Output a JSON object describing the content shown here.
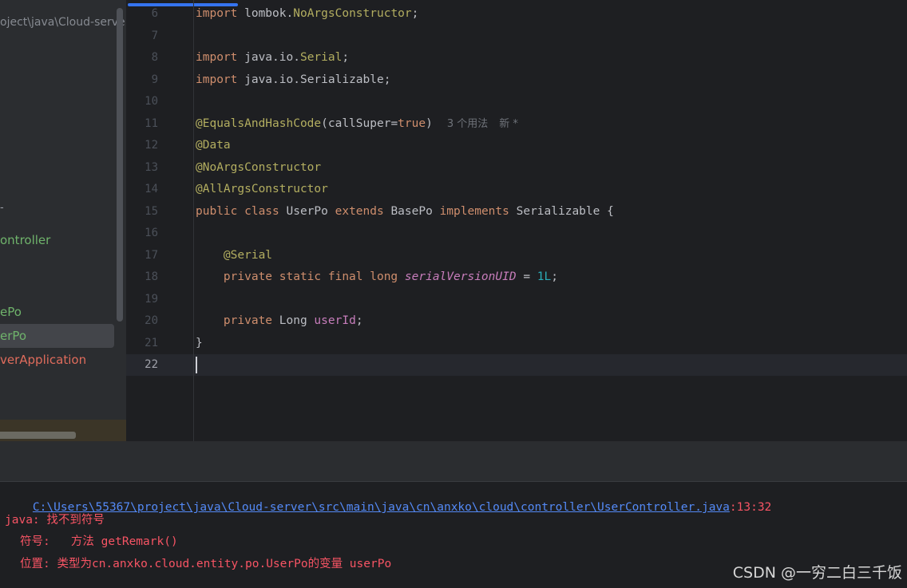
{
  "sidebar": {
    "path_text": "oject\\java\\Cloud-serve",
    "dash": "-",
    "items": [
      {
        "label": "ontroller"
      },
      {
        "label": "ePo"
      },
      {
        "label": "erPo"
      },
      {
        "label": "verApplication"
      }
    ]
  },
  "editor": {
    "lines": [
      {
        "n": "6",
        "tokens": [
          [
            "kw",
            "import"
          ],
          [
            "plain",
            " lombok."
          ],
          [
            "ann",
            "NoArgsConstructor"
          ],
          [
            "plain",
            ";"
          ]
        ]
      },
      {
        "n": "7",
        "tokens": []
      },
      {
        "n": "8",
        "tokens": [
          [
            "kw",
            "import"
          ],
          [
            "plain",
            " java.io."
          ],
          [
            "ann",
            "Serial"
          ],
          [
            "plain",
            ";"
          ]
        ]
      },
      {
        "n": "9",
        "tokens": [
          [
            "kw",
            "import"
          ],
          [
            "plain",
            " java.io.Serializable;"
          ]
        ]
      },
      {
        "n": "10",
        "tokens": []
      },
      {
        "n": "11",
        "tokens": [
          [
            "ann",
            "@EqualsAndHashCode"
          ],
          [
            "plain",
            "(callSuper="
          ],
          [
            "kw",
            "true"
          ],
          [
            "plain",
            ")"
          ],
          [
            "inlay",
            "3 个用法"
          ],
          [
            "inlay2",
            "新 *"
          ]
        ]
      },
      {
        "n": "12",
        "tokens": [
          [
            "ann",
            "@Data"
          ]
        ]
      },
      {
        "n": "13",
        "tokens": [
          [
            "ann",
            "@NoArgsConstructor"
          ]
        ]
      },
      {
        "n": "14",
        "tokens": [
          [
            "ann",
            "@AllArgsConstructor"
          ]
        ]
      },
      {
        "n": "15",
        "tokens": [
          [
            "kw",
            "public class"
          ],
          [
            "plain",
            " UserPo "
          ],
          [
            "kw",
            "extends"
          ],
          [
            "plain",
            " BasePo "
          ],
          [
            "kw",
            "implements"
          ],
          [
            "plain",
            " Serializable {"
          ]
        ]
      },
      {
        "n": "16",
        "tokens": []
      },
      {
        "n": "17",
        "tokens": [
          [
            "plain",
            "    "
          ],
          [
            "ann",
            "@Serial"
          ]
        ]
      },
      {
        "n": "18",
        "tokens": [
          [
            "plain",
            "    "
          ],
          [
            "kw",
            "private static final long"
          ],
          [
            "plain",
            " "
          ],
          [
            "ital",
            "serialVersionUID"
          ],
          [
            "plain",
            " = "
          ],
          [
            "num",
            "1L"
          ],
          [
            "plain",
            ";"
          ]
        ]
      },
      {
        "n": "19",
        "tokens": []
      },
      {
        "n": "20",
        "tokens": [
          [
            "plain",
            "    "
          ],
          [
            "kw",
            "private"
          ],
          [
            "plain",
            " Long "
          ],
          [
            "fn",
            "userId"
          ],
          [
            "plain",
            ";"
          ]
        ]
      },
      {
        "n": "21",
        "tokens": [
          [
            "plain",
            "}"
          ]
        ]
      },
      {
        "n": "22",
        "tokens": [
          [
            "caret",
            ""
          ]
        ],
        "current": true
      }
    ]
  },
  "console": {
    "file_path": "C:\\Users\\55367\\project\\java\\Cloud-server\\src\\main\\java\\cn\\anxko\\cloud\\controller\\UserController.java",
    "position": ":13:32",
    "error": "java: 找不到符号",
    "symbol": "符号:   方法 getRemark()",
    "location": "位置: 类型为cn.anxko.cloud.entity.po.UserPo的变量 userPo"
  },
  "watermark": "CSDN @一穷二白三千饭",
  "colors": {
    "keyword": "#cf8e6d",
    "annotation": "#b3ae60",
    "field": "#c77dbb",
    "number": "#2aacb8",
    "error": "#f75464",
    "link": "#548af7",
    "accent": "#3574f0"
  }
}
